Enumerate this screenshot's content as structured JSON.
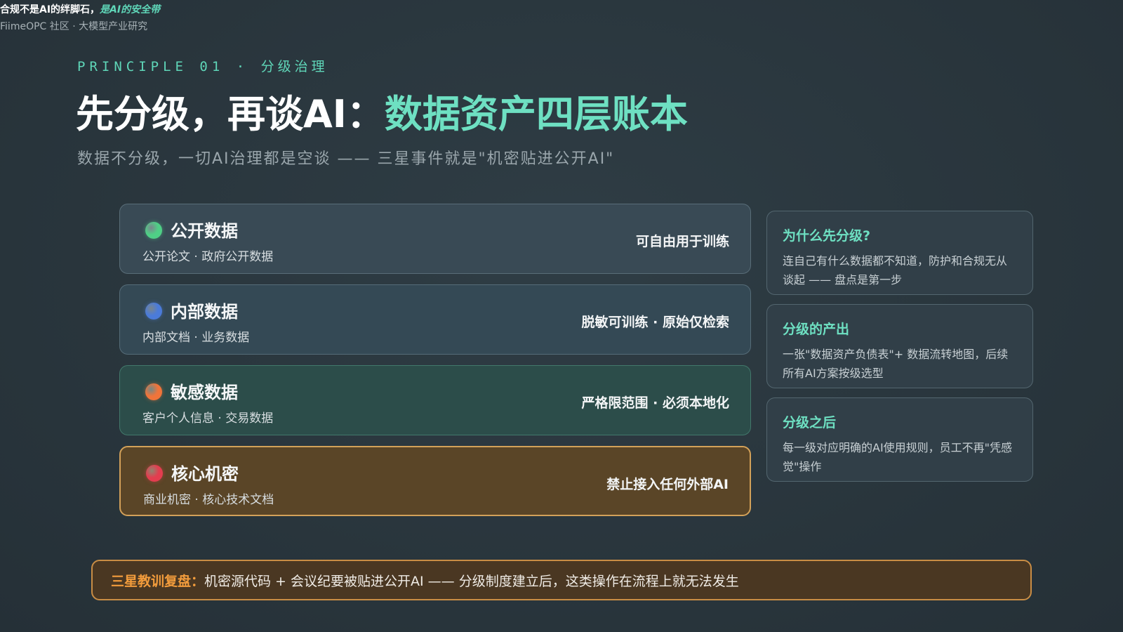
{
  "header": {
    "title_main": "合规不是AI的绊脚石，",
    "title_accent": "是AI的安全带",
    "subtitle": "FiimeOPC 社区 · 大模型产业研究"
  },
  "slide": {
    "eyebrow_code": "PRINCIPLE 01 · ",
    "eyebrow_cn": "分级治理",
    "headline_main": "先分级，再谈AI：",
    "headline_accent": "数据资产四层账本",
    "subline": "数据不分级，一切AI治理都是空谈 —— 三星事件就是\"机密贴进公开AI\""
  },
  "tiers": [
    {
      "name": "公开数据",
      "desc": "公开论文 · 政府公开数据",
      "rule": "可自由用于训练",
      "color": "#4fcf86"
    },
    {
      "name": "内部数据",
      "desc": "内部文档 · 业务数据",
      "rule": "脱敏可训练 · 原始仅检索",
      "color": "#4b7bd9"
    },
    {
      "name": "敏感数据",
      "desc": "客户个人信息 · 交易数据",
      "rule": "严格限范围 · 必须本地化",
      "color": "#f0743a"
    },
    {
      "name": "核心机密",
      "desc": "商业机密 · 核心技术文档",
      "rule": "禁止接入任何外部AI",
      "color": "#e33d4f"
    }
  ],
  "side_cards": [
    {
      "title": "为什么先分级?",
      "body": "连自己有什么数据都不知道，防护和合规无从谈起 —— 盘点是第一步"
    },
    {
      "title": "分级的产出",
      "body": "一张\"数据资产负债表\"+ 数据流转地图，后续所有AI方案按级选型"
    },
    {
      "title": "分级之后",
      "body": "每一级对应明确的AI使用规则，员工不再\"凭感觉\"操作"
    }
  ],
  "footer": {
    "lead": "三星教训复盘：",
    "text": "机密源代码 + 会议纪要被贴进公开AI —— 分级制度建立后，这类操作在流程上就无法发生"
  }
}
